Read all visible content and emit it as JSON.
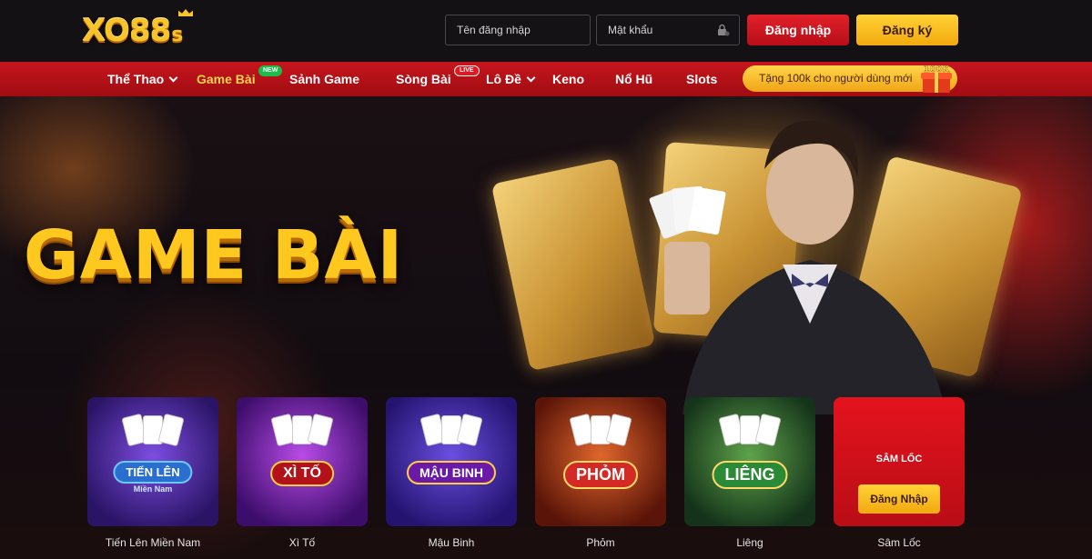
{
  "brand": {
    "logo_text": "XO88",
    "logo_suffix": "s"
  },
  "auth": {
    "username_placeholder": "Tên đăng nhập",
    "password_placeholder": "Mật khẩu",
    "login_label": "Đăng nhập",
    "register_label": "Đăng ký"
  },
  "nav": {
    "items": [
      {
        "label": "Thể Thao",
        "has_dropdown": true
      },
      {
        "label": "Game Bài",
        "active": true,
        "badge": "NEW"
      },
      {
        "label": "Sảnh Game"
      },
      {
        "label": "Sòng Bài",
        "badge": "LIVE"
      },
      {
        "label": "Lô Đề",
        "has_dropdown": true
      },
      {
        "label": "Keno"
      },
      {
        "label": "Nổ Hũ"
      },
      {
        "label": "Slots"
      }
    ],
    "promo_text": "Tặng 100k cho người dùng mới",
    "gift_text": "100K"
  },
  "hero": {
    "title": "GAME BÀI"
  },
  "games": [
    {
      "label": "Tiến Lên Miền Nam",
      "plate": "TIẾN LÊN",
      "plate_sub": "Miền Nam",
      "theme": "#5a2fb3"
    },
    {
      "label": "Xì Tố",
      "plate": "XÌ TỐ",
      "theme": "#7b1fb0"
    },
    {
      "label": "Mậu Binh",
      "plate": "MẬU BINH",
      "theme": "#4b2aa8"
    },
    {
      "label": "Phỏm",
      "plate": "PHỎM",
      "theme": "#b2321c"
    },
    {
      "label": "Liêng",
      "plate": "LIÊNG",
      "theme": "#2f6b2a"
    },
    {
      "label": "Sâm Lốc",
      "locked_title": "SÂM LỐC",
      "locked_button": "Đăng Nhập",
      "theme": "#d5151f"
    }
  ],
  "colors": {
    "nav_red": "#c8151d",
    "gold": "#ffc81f",
    "login_red": "#e2212b",
    "register_gold": "#ffd235"
  }
}
